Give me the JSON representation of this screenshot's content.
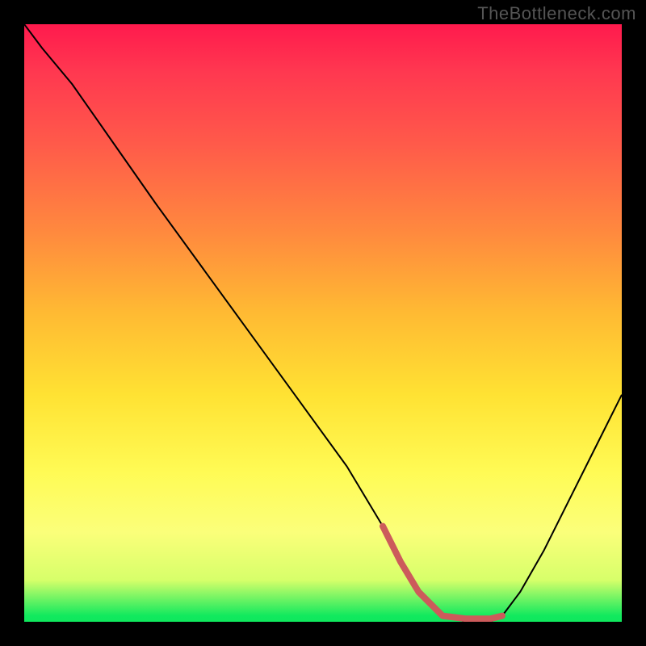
{
  "watermark": "TheBottleneck.com",
  "colors": {
    "black": "#000000",
    "highlight": "#cc5b5b",
    "gradient_top": "#ff1a4d",
    "gradient_mid": "#ffe233",
    "gradient_bottom": "#10e85d"
  },
  "chart_data": {
    "type": "line",
    "title": "",
    "xlabel": "",
    "ylabel": "",
    "xlim": [
      0,
      100
    ],
    "ylim": [
      0,
      100
    ],
    "x": [
      0,
      3,
      8,
      15,
      22,
      30,
      38,
      46,
      54,
      60,
      63,
      66,
      70,
      74,
      78,
      80,
      83,
      87,
      92,
      96,
      100
    ],
    "y": [
      100,
      96,
      90,
      80,
      70,
      59,
      48,
      37,
      26,
      16,
      10,
      5,
      1,
      0,
      0,
      1,
      5,
      12,
      22,
      30,
      38
    ],
    "highlight_segment": {
      "x": [
        60,
        63,
        66,
        70,
        74,
        78,
        80
      ],
      "y": [
        16,
        10,
        5,
        1,
        0,
        0,
        1
      ]
    },
    "note": "x and y are in percent of plot width/height. y=0 at bottom (green), y=100 at top (red). The curve is a V-shaped bottleneck profile dipping to the green band around x≈70–78."
  }
}
